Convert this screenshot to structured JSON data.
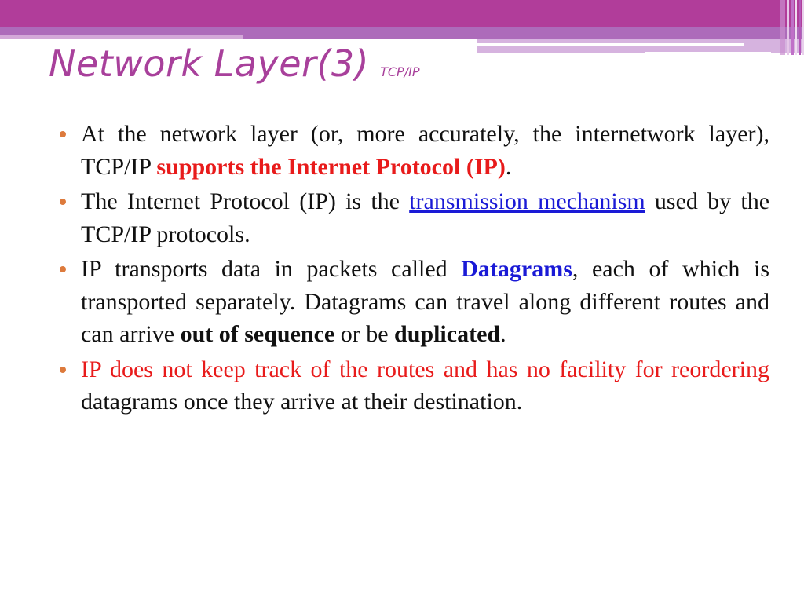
{
  "header": {
    "title": "Network Layer(3)",
    "subtitle": "TCP/IP",
    "colors": {
      "band_primary": "#b13d9a",
      "band_secondary": "#ad6bba",
      "title": "#a8409b",
      "bullet": "#dd7a3c"
    }
  },
  "bullets": [
    {
      "parts": [
        {
          "text": "At the network layer (or, more accurately, the internetwork layer), TCP/IP ",
          "style": "normal"
        },
        {
          "text": "supports the Internet Protocol (IP)",
          "style": "red-bold"
        },
        {
          "text": ".",
          "style": "normal"
        }
      ]
    },
    {
      "parts": [
        {
          "text": "The Internet Protocol (IP) is the ",
          "style": "normal"
        },
        {
          "text": "transmission mechanism",
          "style": "link"
        },
        {
          "text": " used by the TCP/IP protocols.",
          "style": "normal"
        }
      ]
    },
    {
      "parts": [
        {
          "text": "IP transports data in packets called ",
          "style": "normal"
        },
        {
          "text": "Datagrams",
          "style": "blue-bold"
        },
        {
          "text": ", each of which is transported separately. Datagrams can travel along different routes and can arrive ",
          "style": "normal"
        },
        {
          "text": "out of sequence",
          "style": "bold"
        },
        {
          "text": " or be ",
          "style": "normal"
        },
        {
          "text": "duplicated",
          "style": "bold"
        },
        {
          "text": ".",
          "style": "normal"
        }
      ]
    },
    {
      "parts": [
        {
          "text": "IP does not keep track of the routes and has no facility for reordering",
          "style": "red"
        },
        {
          "text": " datagrams once they arrive at their destination.",
          "style": "normal"
        }
      ]
    }
  ]
}
